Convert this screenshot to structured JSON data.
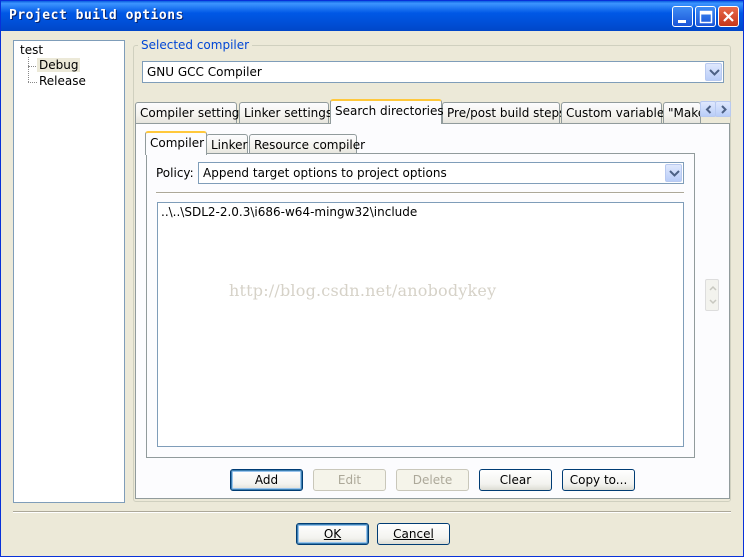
{
  "window": {
    "title": "Project build options"
  },
  "tree": {
    "root": "test",
    "items": [
      "Debug",
      "Release"
    ]
  },
  "compiler_group": {
    "label": "Selected compiler",
    "selected": "GNU GCC Compiler"
  },
  "tabs": {
    "items": [
      "Compiler settings",
      "Linker settings",
      "Search directories",
      "Pre/post build steps",
      "Custom variables",
      "\"Make"
    ],
    "active": "Search directories"
  },
  "inner_tabs": {
    "items": [
      "Compiler",
      "Linker",
      "Resource compiler"
    ],
    "active": "Compiler"
  },
  "policy": {
    "label": "Policy:",
    "value": "Append target options to project options"
  },
  "directories": [
    "..\\..\\SDL2-2.0.3\\i686-w64-mingw32\\include"
  ],
  "watermark": "http://blog.csdn.net/anobodykey",
  "actions": {
    "add": "Add",
    "edit": "Edit",
    "delete": "Delete",
    "clear": "Clear",
    "copy_to": "Copy to..."
  },
  "dialog_buttons": {
    "ok": "OK",
    "cancel": "Cancel"
  },
  "colors": {
    "titlebar": "#0054e3",
    "group_label": "#0046d5",
    "active_tab_accent": "#ffc83c",
    "dialog_bg": "#ece9d8"
  }
}
